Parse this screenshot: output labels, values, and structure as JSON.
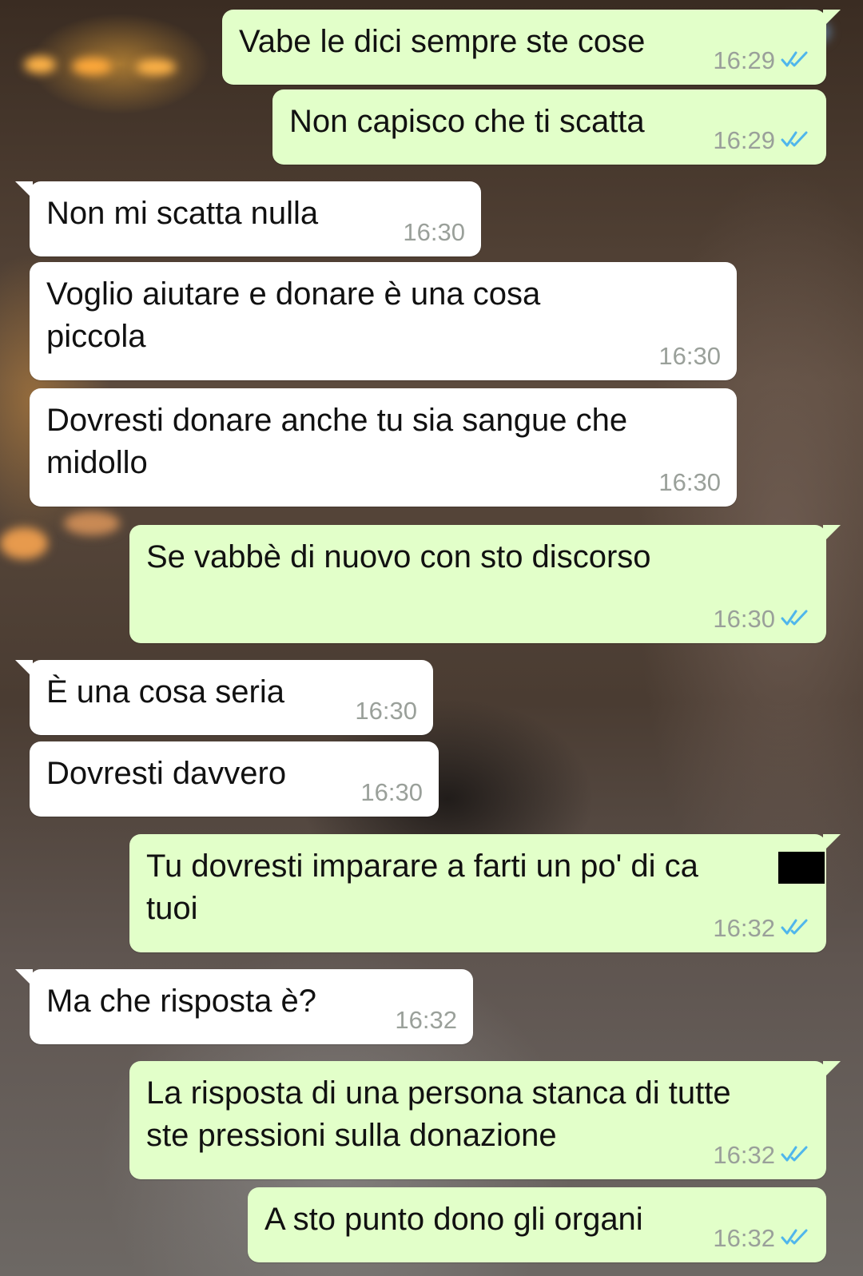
{
  "messages": [
    {
      "from": "me",
      "text": "Vabe le dici sempre ste cose",
      "time": "16:29",
      "read": true
    },
    {
      "from": "me",
      "text": "Non capisco che ti scatta",
      "time": "16:29",
      "read": true
    },
    {
      "from": "them",
      "text": "Non mi scatta nulla",
      "time": "16:30"
    },
    {
      "from": "them",
      "text": "Voglio aiutare e donare è una cosa\npiccola",
      "time": "16:30"
    },
    {
      "from": "them",
      "text": "Dovresti donare anche tu sia sangue che\nmidollo",
      "time": "16:30"
    },
    {
      "from": "me",
      "text": "Se vabbè di nuovo con sto discorso",
      "time": "16:30",
      "read": true
    },
    {
      "from": "them",
      "text": "È una cosa seria",
      "time": "16:30"
    },
    {
      "from": "them",
      "text": "Dovresti davvero",
      "time": "16:30"
    },
    {
      "from": "me",
      "text": "Tu dovresti imparare a farti un po' di ca\ntuoi",
      "time": "16:32",
      "read": true
    },
    {
      "from": "them",
      "text": "Ma che risposta è?",
      "time": "16:32"
    },
    {
      "from": "me",
      "text": "La risposta di una persona stanca di tutte\nste pressioni sulla donazione",
      "time": "16:32",
      "read": true
    },
    {
      "from": "me",
      "text": "A sto punto dono gli organi",
      "time": "16:32",
      "read": true
    }
  ],
  "colors": {
    "incoming_bubble": "#ffffff",
    "outgoing_bubble": "#e2ffc9",
    "read_ticks": "#4fb6ec",
    "timestamp": "#9aa09a"
  },
  "icons": {
    "read_receipt": "double-check-icon"
  }
}
